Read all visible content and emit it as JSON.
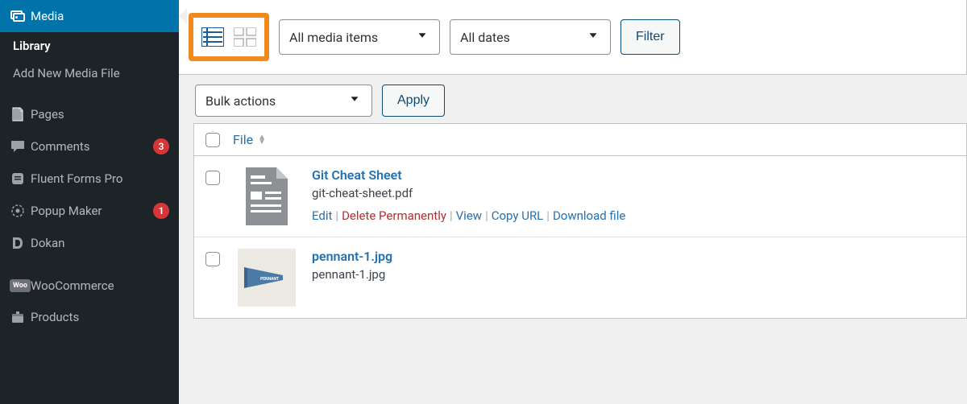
{
  "sidebar": {
    "active_label": "Media",
    "sub": [
      {
        "label": "Library",
        "current": true
      },
      {
        "label": "Add New Media File",
        "current": false
      }
    ],
    "items": [
      {
        "label": "Pages",
        "icon": "pages",
        "badge": null
      },
      {
        "label": "Comments",
        "icon": "comment",
        "badge": "3"
      },
      {
        "label": "Fluent Forms Pro",
        "icon": "form",
        "badge": null
      },
      {
        "label": "Popup Maker",
        "icon": "popup",
        "badge": "1"
      },
      {
        "label": "Dokan",
        "icon": "dokan",
        "badge": null
      },
      {
        "label": "WooCommerce",
        "icon": "woo",
        "badge": null,
        "spacer_before": true
      },
      {
        "label": "Products",
        "icon": "products",
        "badge": null
      }
    ]
  },
  "toolbar": {
    "media_filter": "All media items",
    "date_filter": "All dates",
    "filter_btn": "Filter"
  },
  "bulkbar": {
    "select_label": "Bulk actions",
    "apply": "Apply"
  },
  "table": {
    "col_file": "File",
    "rows": [
      {
        "title": "Git Cheat Sheet",
        "filename": "git-cheat-sheet.pdf",
        "thumb": "doc",
        "actions": [
          "Edit",
          "Delete Permanently",
          "View",
          "Copy URL",
          "Download file"
        ]
      },
      {
        "title": "pennant-1.jpg",
        "filename": "pennant-1.jpg",
        "thumb": "img",
        "actions": []
      }
    ]
  }
}
